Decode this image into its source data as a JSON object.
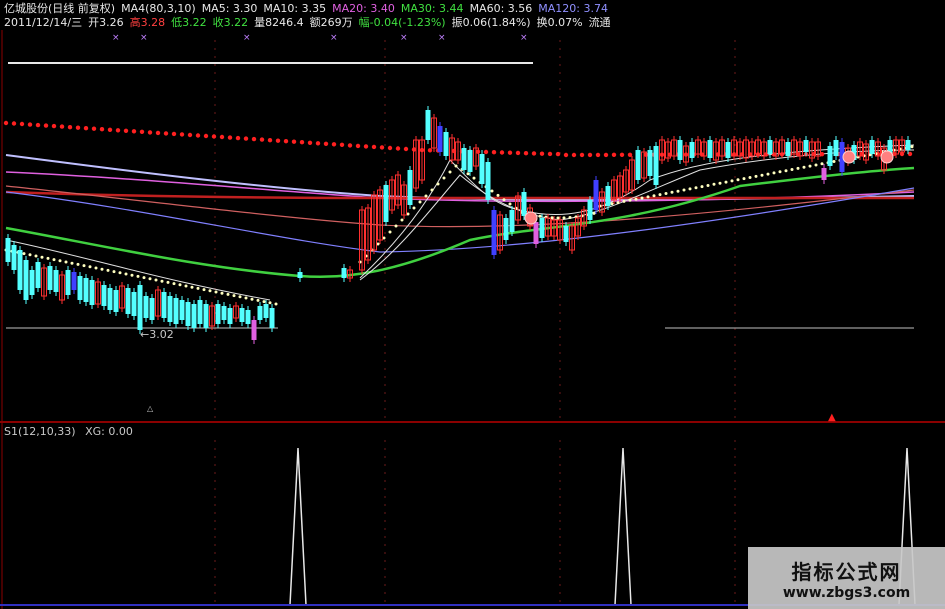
{
  "header": {
    "row1": [
      {
        "text": "亿城股份(日线 前复权)",
        "color": "#e8e8e8"
      },
      {
        "text": "MA4(80,3,10)",
        "color": "#e8e8e8"
      },
      {
        "text": "MA5: 3.30",
        "color": "#e8e8e8"
      },
      {
        "text": "MA10: 3.35",
        "color": "#e8e8e8"
      },
      {
        "text": "MA20: 3.40",
        "color": "#e060e0"
      },
      {
        "text": "MA30: 3.44",
        "color": "#40e040"
      },
      {
        "text": "MA60: 3.56",
        "color": "#e8e8e8"
      },
      {
        "text": "MA120: 3.74",
        "color": "#9090ff"
      }
    ],
    "row2": [
      {
        "text": "2011/12/14/三",
        "color": "#e8e8e8"
      },
      {
        "text": "开3.26",
        "color": "#e8e8e8"
      },
      {
        "text": "高3.28",
        "color": "#ff4040"
      },
      {
        "text": "低3.22",
        "color": "#40e040"
      },
      {
        "text": "收3.22",
        "color": "#40e040"
      },
      {
        "text": "量8246.4",
        "color": "#e8e8e8"
      },
      {
        "text": "额269万",
        "color": "#e8e8e8"
      },
      {
        "text": "幅-0.04(-1.23%)",
        "color": "#40e040"
      },
      {
        "text": "振0.06(1.84%)",
        "color": "#e8e8e8"
      },
      {
        "text": "换0.07%",
        "color": "#e8e8e8"
      },
      {
        "text": "流通",
        "color": "#e8e8e8"
      }
    ]
  },
  "main": {
    "low_label": "←3.02",
    "markers": [
      "×",
      "×",
      "×",
      "×",
      "×",
      "×",
      "×"
    ]
  },
  "sub": {
    "indicator": "S1(12,10,33)",
    "xg_label": "XG: 0.00"
  },
  "watermark": {
    "line1": "指标公式网",
    "line2": "www.zbgs3.com"
  },
  "colors": {
    "up": "#ff3030",
    "down": "#54ffff",
    "divider": "#8b0000",
    "ma_white": "#e0e0e0",
    "ma_green": "#40d040",
    "ma_purple": "#b0a0ff",
    "dots": "#ff2020"
  }
}
